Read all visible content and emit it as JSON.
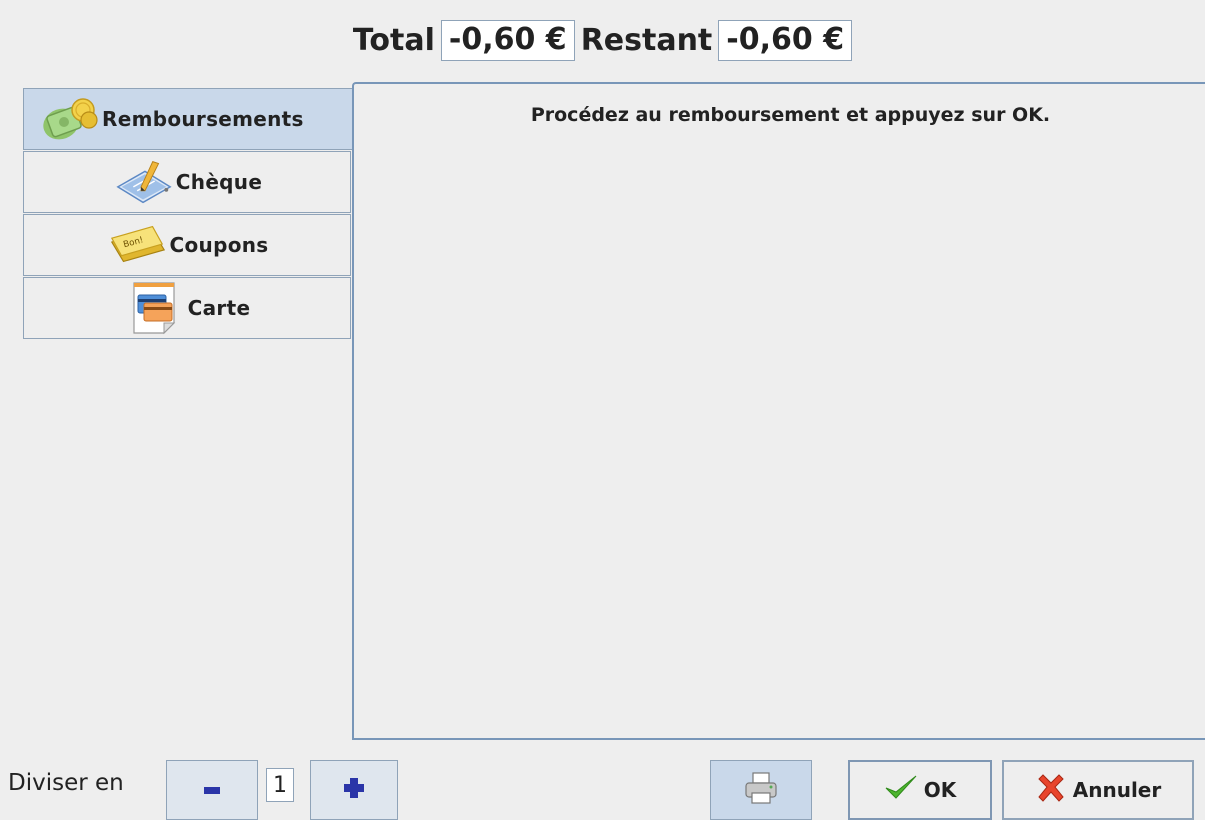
{
  "header": {
    "total_label": "Total",
    "total_value": "-0,60 €",
    "remaining_label": "Restant",
    "remaining_value": "-0,60 €"
  },
  "tabs": [
    {
      "label": "Remboursements",
      "icon": "cash-refund-icon",
      "selected": true
    },
    {
      "label": "Chèque",
      "icon": "cheque-pen-icon",
      "selected": false
    },
    {
      "label": "Coupons",
      "icon": "coupon-ticket-icon",
      "selected": false
    },
    {
      "label": "Carte",
      "icon": "credit-card-icon",
      "selected": false
    }
  ],
  "panel": {
    "message": "Procédez au remboursement et appuyez sur OK."
  },
  "bottom": {
    "split_label": "Diviser en",
    "split_count": "1",
    "ok_label": "OK",
    "cancel_label": "Annuler"
  },
  "colors": {
    "background": "#eeeeee",
    "selected_tab": "#c9d8ea",
    "border": "#8fa3b8",
    "panel_border": "#7896b8"
  }
}
